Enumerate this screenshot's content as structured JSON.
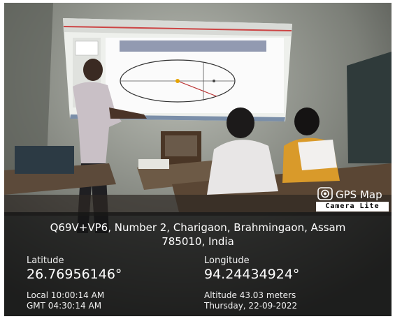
{
  "watermark": {
    "app_name": "GPS Map",
    "badge": "Camera Lite",
    "icon": "camera-lens-icon"
  },
  "location": {
    "address_line1": "Q69V+VP6, Number 2, Charigaon, Brahmingaon, Assam",
    "address_line2": "785010, India",
    "latitude_label": "Latitude",
    "latitude_value": "26.76956146°",
    "longitude_label": "Longitude",
    "longitude_value": "94.24434924°",
    "local_time": "Local 10:00:14 AM",
    "gmt_time": "GMT 04:30:14 AM",
    "altitude": "Altitude 43.03 meters",
    "date": "Thursday, 22-09-2022"
  },
  "colors": {
    "overlay": "#141414",
    "wall": "#8a8c84",
    "projection": "#f2f4f0"
  }
}
